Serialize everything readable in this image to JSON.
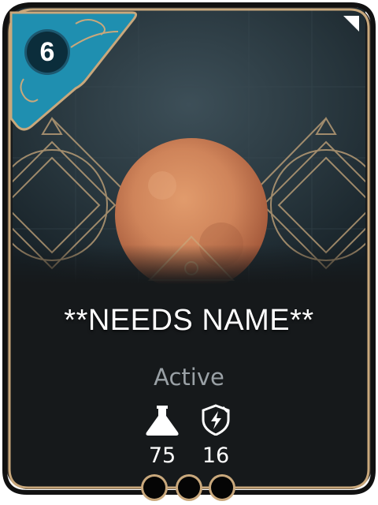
{
  "card": {
    "cost": "6",
    "name": "**NEEDS NAME**",
    "subtype": "Active",
    "stats": [
      {
        "icon": "flask-icon",
        "value": "75"
      },
      {
        "icon": "shield-lightning-icon",
        "value": "16"
      }
    ],
    "slots": 3
  },
  "colors": {
    "frame_gold": "#c9a87c",
    "cost_badge": "#1f8fb0",
    "card_dark": "#16191b",
    "planet": "#d48a5e"
  }
}
